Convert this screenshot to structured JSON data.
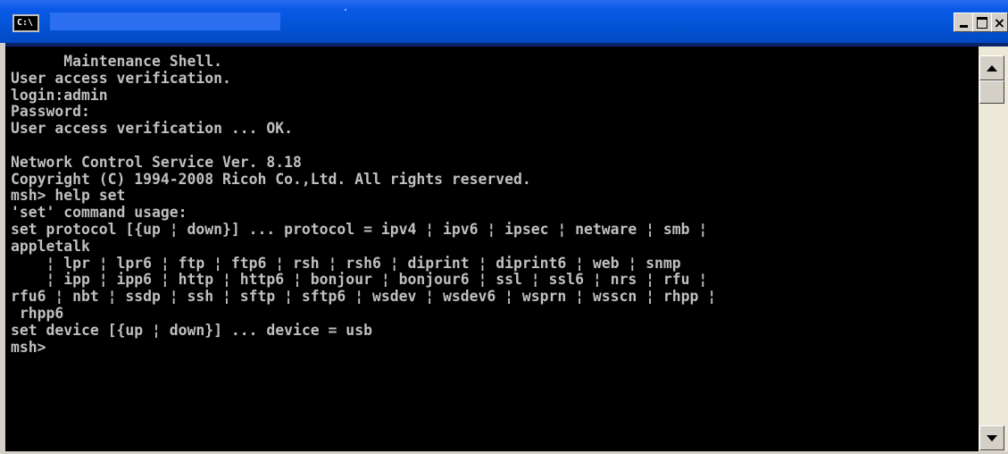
{
  "window": {
    "icon_label": "C:\\",
    "title": "",
    "controls": {
      "minimize": "minimize",
      "maximize": "maximize",
      "close": "×"
    }
  },
  "console": {
    "lines": [
      "      Maintenance Shell.",
      "User access verification.",
      "login:admin",
      "Password:",
      "User access verification ... OK.",
      "",
      "Network Control Service Ver. 8.18",
      "Copyright (C) 1994-2008 Ricoh Co.,Ltd. All rights reserved.",
      "msh> help set",
      "'set' command usage:",
      "set protocol [{up ¦ down}] ... protocol = ipv4 ¦ ipv6 ¦ ipsec ¦ netware ¦ smb ¦",
      "appletalk",
      "    ¦ lpr ¦ lpr6 ¦ ftp ¦ ftp6 ¦ rsh ¦ rsh6 ¦ diprint ¦ diprint6 ¦ web ¦ snmp",
      "    ¦ ipp ¦ ipp6 ¦ http ¦ http6 ¦ bonjour ¦ bonjour6 ¦ ssl ¦ ssl6 ¦ nrs ¦ rfu ¦",
      "rfu6 ¦ nbt ¦ ssdp ¦ ssh ¦ sftp ¦ sftp6 ¦ wsdev ¦ wsdev6 ¦ wsprn ¦ wsscn ¦ rhpp ¦",
      " rhpp6",
      "set device [{up ¦ down}] ... device = usb",
      "msh>"
    ]
  },
  "colors": {
    "titlebar": "#0354d6",
    "console_bg": "#000000",
    "console_fg": "#c0c0c0"
  },
  "icons": {
    "app": "cmd-icon",
    "scroll_up": "arrow-up-icon",
    "scroll_down": "arrow-down-icon"
  }
}
